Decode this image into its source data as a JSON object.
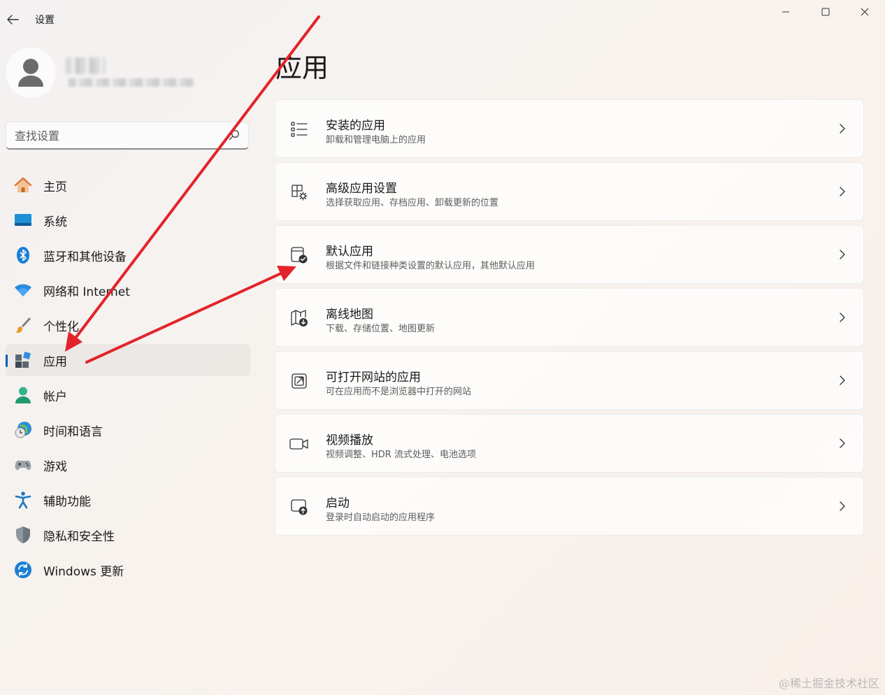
{
  "window": {
    "title": "设置",
    "controls": {
      "minimize_icon": "minimize-icon",
      "maximize_icon": "maximize-icon",
      "close_icon": "close-icon"
    }
  },
  "search": {
    "placeholder": "查找设置"
  },
  "sidebar": {
    "items": [
      {
        "label": "主页",
        "icon": "home-icon",
        "active": false
      },
      {
        "label": "系统",
        "icon": "system-icon",
        "active": false
      },
      {
        "label": "蓝牙和其他设备",
        "icon": "bluetooth-icon",
        "active": false
      },
      {
        "label": "网络和 Internet",
        "icon": "wifi-icon",
        "active": false
      },
      {
        "label": "个性化",
        "icon": "brush-icon",
        "active": false
      },
      {
        "label": "应用",
        "icon": "apps-icon",
        "active": true
      },
      {
        "label": "帐户",
        "icon": "account-icon",
        "active": false
      },
      {
        "label": "时间和语言",
        "icon": "clock-globe-icon",
        "active": false
      },
      {
        "label": "游戏",
        "icon": "gamepad-icon",
        "active": false
      },
      {
        "label": "辅助功能",
        "icon": "accessibility-icon",
        "active": false
      },
      {
        "label": "隐私和安全性",
        "icon": "shield-icon",
        "active": false
      },
      {
        "label": "Windows 更新",
        "icon": "update-icon",
        "active": false
      }
    ]
  },
  "main": {
    "title": "应用",
    "cards": [
      {
        "title": "安装的应用",
        "desc": "卸载和管理电脑上的应用",
        "icon": "list-icon"
      },
      {
        "title": "高级应用设置",
        "desc": "选择获取应用、存档应用、卸载更新的位置",
        "icon": "app-settings-icon"
      },
      {
        "title": "默认应用",
        "desc": "根据文件和链接种类设置的默认应用，其他默认应用",
        "icon": "default-app-icon"
      },
      {
        "title": "离线地图",
        "desc": "下载、存储位置、地图更新",
        "icon": "map-icon"
      },
      {
        "title": "可打开网站的应用",
        "desc": "可在应用而不是浏览器中打开的网站",
        "icon": "open-link-icon"
      },
      {
        "title": "视频播放",
        "desc": "视频调整、HDR 流式处理、电池选项",
        "icon": "video-icon"
      },
      {
        "title": "启动",
        "desc": "登录时自动启动的应用程序",
        "icon": "startup-icon"
      }
    ]
  },
  "colors": {
    "accent": "#005fb8",
    "annotation_arrow": "#e3232a"
  },
  "watermark": "@稀土掘金技术社区"
}
